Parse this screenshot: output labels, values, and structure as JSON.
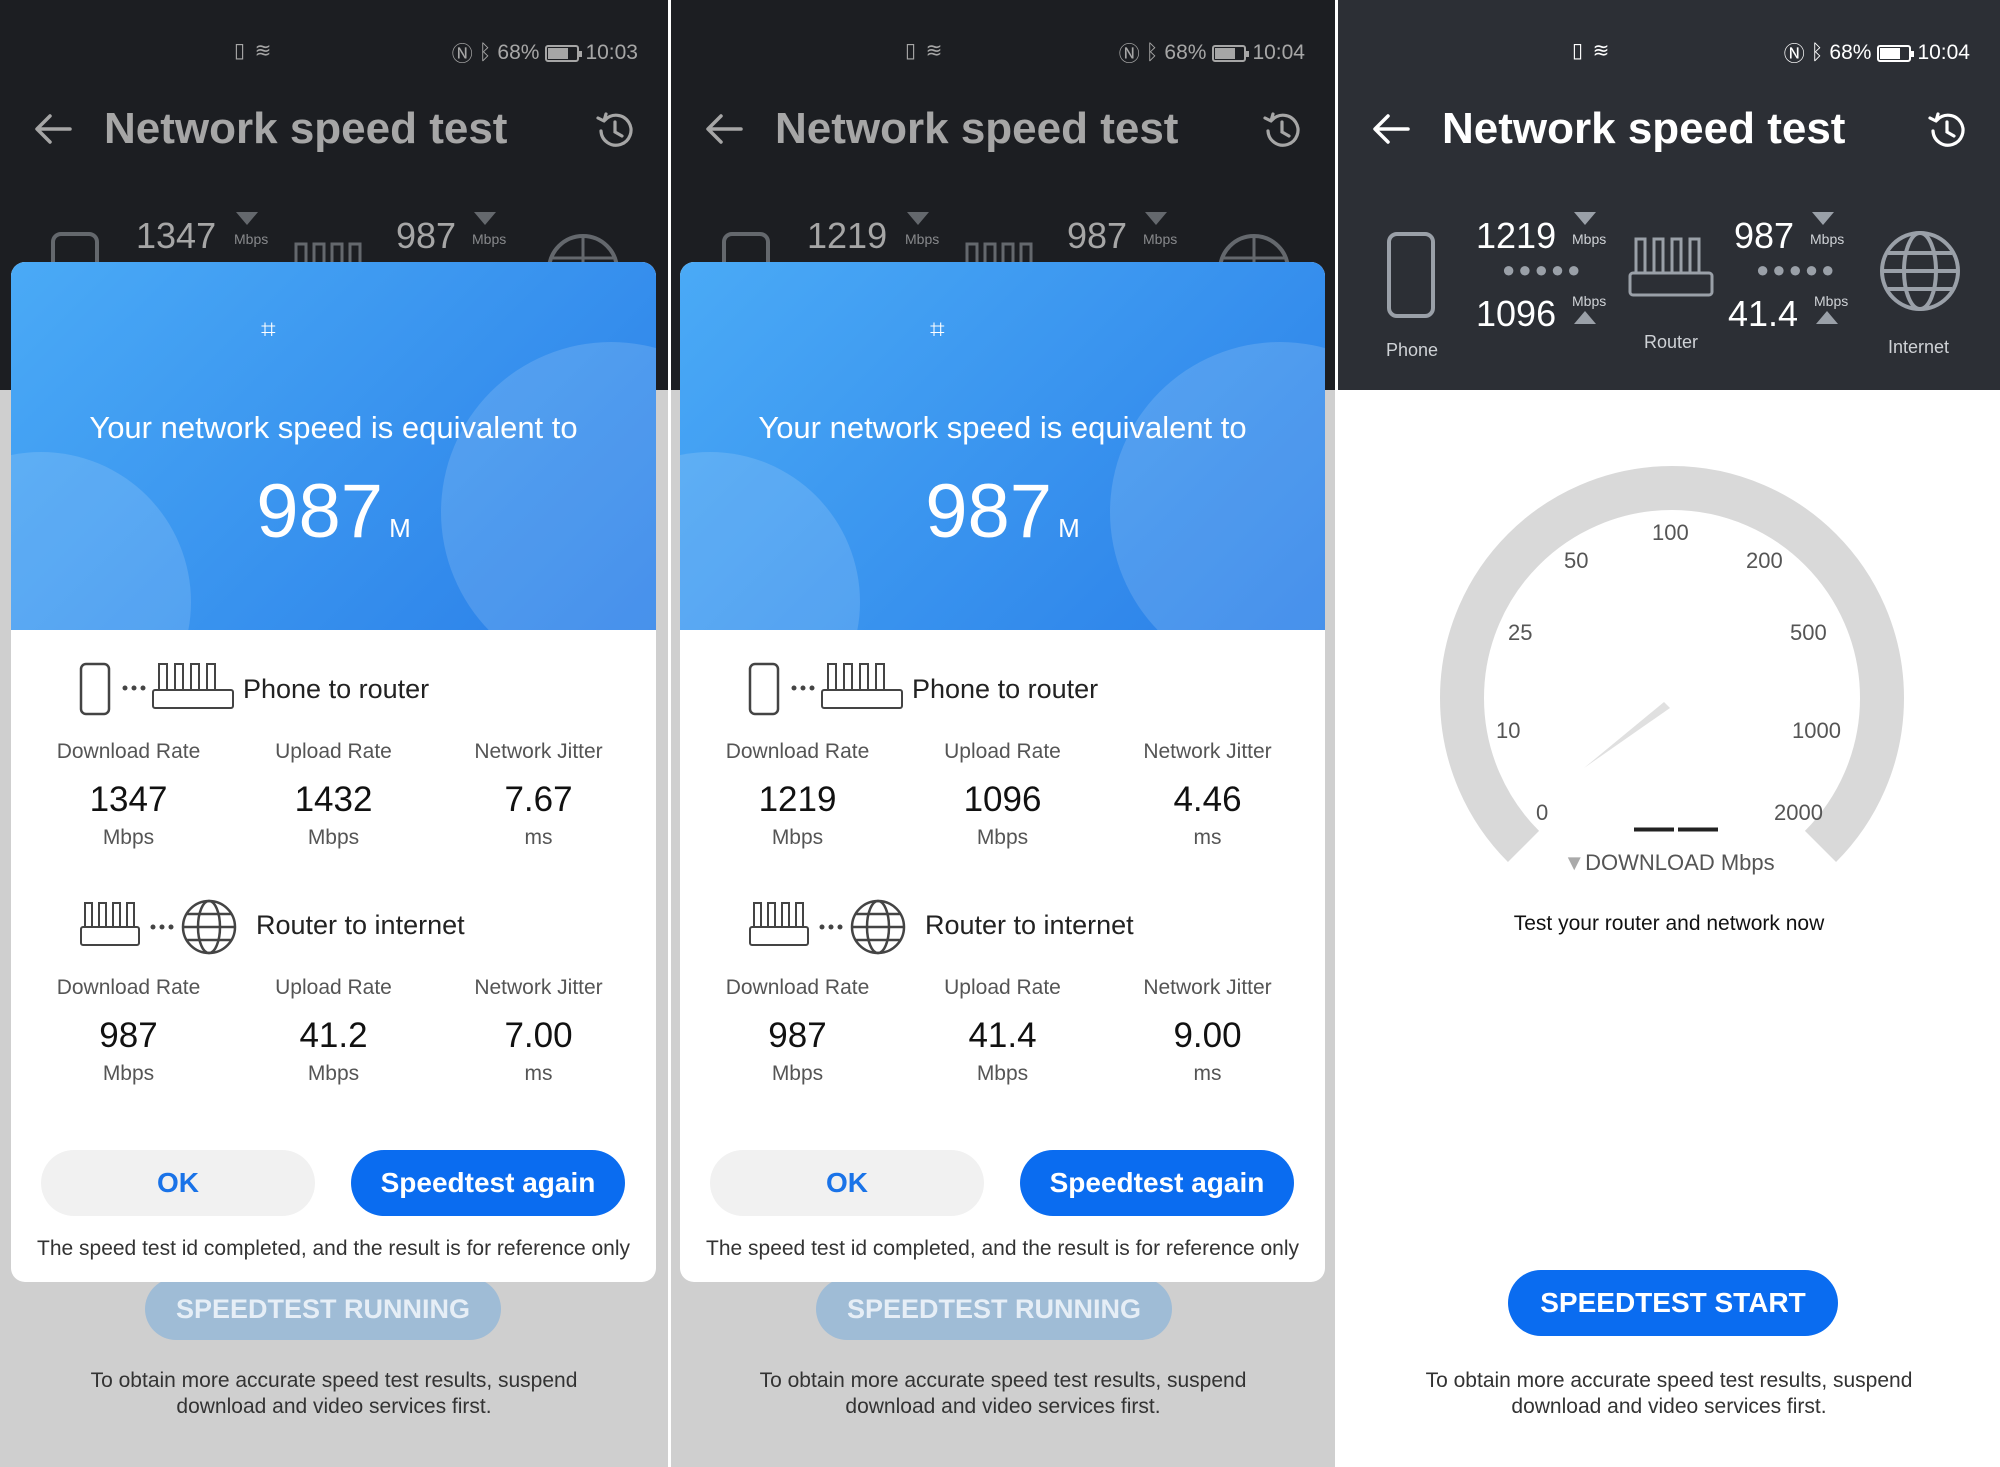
{
  "app": {
    "title": "Network speed test",
    "accent": "#0a6cf0",
    "header_bg": "#2c2f35"
  },
  "screens": [
    {
      "status": {
        "time": "10:03",
        "battery": "68%"
      },
      "topo": {
        "phone_to_router": "1347",
        "router_to_internet": "987",
        "unit": "Mbps"
      },
      "dialog": {
        "headline": "Your network speed is equivalent to",
        "speed_value": "987",
        "speed_unit": "M",
        "section1_title": "Phone to router",
        "section2_title": "Router to internet",
        "labels": {
          "download": "Download Rate",
          "upload": "Upload Rate",
          "jitter": "Network Jitter"
        },
        "phone_router": {
          "download": "1347",
          "upload": "1432",
          "jitter": "7.67"
        },
        "router_internet": {
          "download": "987",
          "upload": "41.2",
          "jitter": "7.00"
        },
        "units": {
          "rate": "Mbps",
          "jitter": "ms"
        },
        "ok": "OK",
        "again": "Speedtest again",
        "note": "The speed test id completed, and the result is for reference only"
      },
      "running": "SPEEDTEST RUNNING",
      "footnote_line1": "To obtain more accurate speed test results, suspend",
      "footnote_line2": "download and video services first."
    },
    {
      "status": {
        "time": "10:04",
        "battery": "68%"
      },
      "topo": {
        "phone_to_router": "1219",
        "router_to_internet": "987",
        "unit": "Mbps"
      },
      "dialog": {
        "headline": "Your network speed is equivalent to",
        "speed_value": "987",
        "speed_unit": "M",
        "section1_title": "Phone to router",
        "section2_title": "Router to internet",
        "labels": {
          "download": "Download Rate",
          "upload": "Upload Rate",
          "jitter": "Network Jitter"
        },
        "phone_router": {
          "download": "1219",
          "upload": "1096",
          "jitter": "4.46"
        },
        "router_internet": {
          "download": "987",
          "upload": "41.4",
          "jitter": "9.00"
        },
        "units": {
          "rate": "Mbps",
          "jitter": "ms"
        },
        "ok": "OK",
        "again": "Speedtest again",
        "note": "The speed test id completed, and the result is for reference only"
      },
      "running": "SPEEDTEST RUNNING",
      "footnote_line1": "To obtain more accurate speed test results, suspend",
      "footnote_line2": "download and video services first."
    },
    {
      "status": {
        "time": "10:04",
        "battery": "68%"
      },
      "topo": {
        "phone_router_down": "1219",
        "phone_router_up": "1096",
        "router_internet_down": "987",
        "router_internet_up": "41.4",
        "unit": "Mbps",
        "phone_label": "Phone",
        "router_label": "Router",
        "internet_label": "Internet"
      },
      "gauge": {
        "ticks": [
          "0",
          "10",
          "25",
          "50",
          "100",
          "200",
          "500",
          "1000",
          "2000"
        ],
        "value": "——",
        "label": "DOWNLOAD Mbps"
      },
      "prompt": "Test your router and network now",
      "start": "SPEEDTEST START",
      "footnote_line1": "To obtain more accurate speed test results, suspend",
      "footnote_line2": "download and video services first."
    }
  ]
}
